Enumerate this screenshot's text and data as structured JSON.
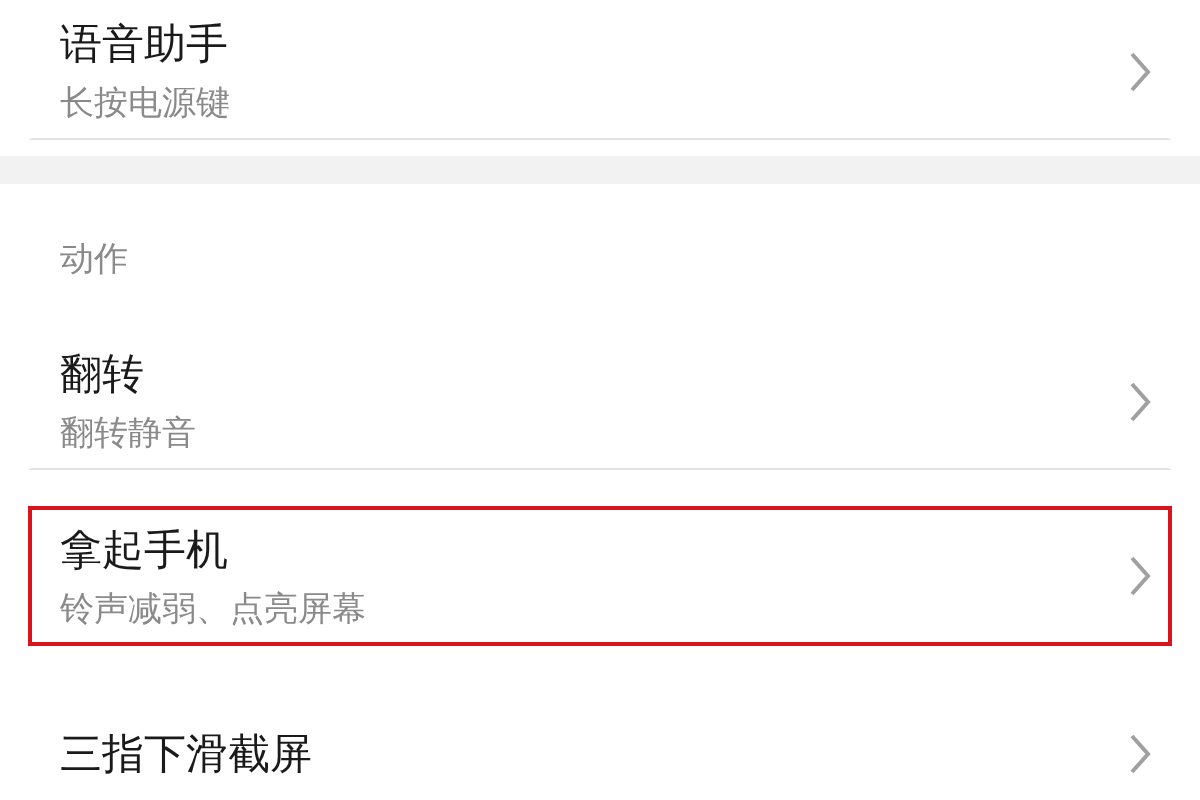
{
  "top_items": [
    {
      "title": "语音助手",
      "subtitle": "长按电源键",
      "highlighted": false
    }
  ],
  "section": {
    "header": "动作",
    "items": [
      {
        "title": "翻转",
        "subtitle": "翻转静音",
        "highlighted": false
      },
      {
        "title": "拿起手机",
        "subtitle": "铃声减弱、点亮屏幕",
        "highlighted": true
      },
      {
        "title": "三指下滑截屏",
        "highlighted": false
      }
    ]
  }
}
